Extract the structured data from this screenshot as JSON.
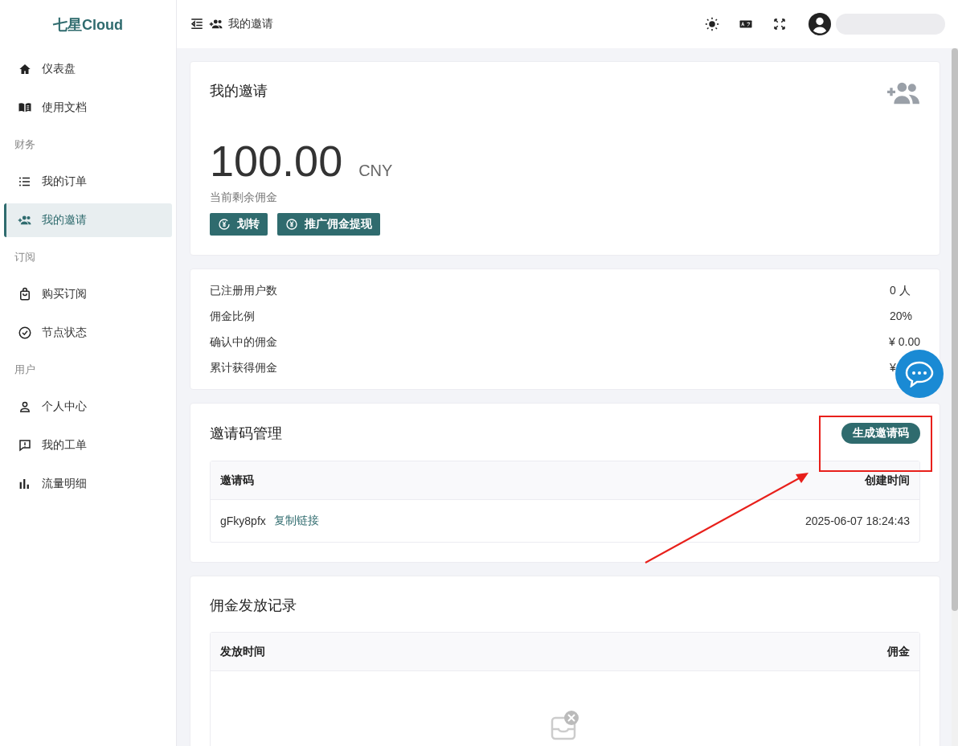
{
  "brand": "七星Cloud",
  "sidebar": {
    "sections": [
      {
        "items": [
          {
            "label": "仪表盘",
            "selected": false
          },
          {
            "label": "使用文档",
            "selected": false
          }
        ]
      },
      {
        "header": "财务",
        "items": [
          {
            "label": "我的订单",
            "selected": false
          },
          {
            "label": "我的邀请",
            "selected": true
          }
        ]
      },
      {
        "header": "订阅",
        "items": [
          {
            "label": "购买订阅",
            "selected": false
          },
          {
            "label": "节点状态",
            "selected": false
          }
        ]
      },
      {
        "header": "用户",
        "items": [
          {
            "label": "个人中心",
            "selected": false
          },
          {
            "label": "我的工单",
            "selected": false
          },
          {
            "label": "流量明细",
            "selected": false
          }
        ]
      }
    ]
  },
  "topbar": {
    "breadcrumb": "我的邀请"
  },
  "balance_card": {
    "title": "我的邀请",
    "amount": "100.00",
    "currency": "CNY",
    "caption": "当前剩余佣金",
    "buttons": [
      "划转",
      "推广佣金提现"
    ]
  },
  "stats": [
    {
      "label": "已注册用户数",
      "value": "0 人"
    },
    {
      "label": "佣金比例",
      "value": "20%"
    },
    {
      "label": "确认中的佣金",
      "value": "¥ 0.00"
    },
    {
      "label": "累计获得佣金",
      "value": "¥"
    }
  ],
  "invite_codes": {
    "title": "邀请码管理",
    "button": "生成邀请码",
    "columns": [
      "邀请码",
      "创建时间"
    ],
    "rows": [
      {
        "code": "gFky8pfx",
        "link": "复制链接",
        "created": "2025-06-07 18:24:43"
      }
    ]
  },
  "commission_records": {
    "title": "佣金发放记录",
    "columns": [
      "发放时间",
      "佣金"
    ]
  }
}
